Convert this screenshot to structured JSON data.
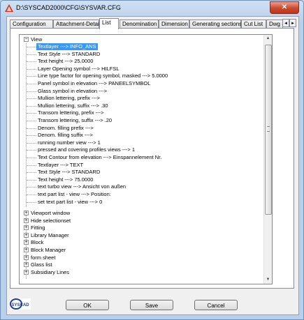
{
  "window": {
    "title": "D:\\SYSCAD2000\\CFG\\SYSVAR.CFG",
    "close_glyph": "✕",
    "icon": "app-icon"
  },
  "tabs": [
    {
      "label": "Configuration",
      "active": false
    },
    {
      "label": "Attachment-Details",
      "active": false
    },
    {
      "label": "List",
      "active": true
    },
    {
      "label": "Denomination",
      "active": false
    },
    {
      "label": "Dimension",
      "active": false
    },
    {
      "label": "Generating sections",
      "active": false
    },
    {
      "label": "Cut List",
      "active": false
    },
    {
      "label": "Dwg S",
      "active": false
    }
  ],
  "tab_scroll": {
    "left": "◄",
    "right": "►"
  },
  "tree": {
    "root": {
      "label": "View",
      "expander": "−"
    },
    "children": [
      "Textlayer  --->  INFO_ANS",
      "Text Style  --->  STANDARD",
      "Text height  --->  25.0000",
      "Layer Opening symbol  --->  HILFSL",
      "Line type factor for opening symbol, masked  --->  5.0000",
      "Panel symbol in elevation  --->  PANEELSYMBOL",
      "Glass symbol in elevation  --->",
      "Mullion lettering, prefix  --->",
      "Mullion lettering, suffix  --->  .30",
      "Transom lettering, prefix  --->",
      "Transom lettering, suffix  --->  .20",
      "Denom. filling prefix  --->",
      "Denom. filling suffix  --->",
      "running number view  --->  1",
      "pressed and covering profiles views  --->  1",
      "Text Contour from elevation  --->  Einspannelement Nr.",
      "Textlayer  --->  TEXT",
      "Text Style  --->  STANDARD",
      "Text height  --->  75.0000",
      "text turbo view  --->  Ansicht von außen",
      "text part list - view  --->  Position:",
      "set text part list - view  --->  0"
    ],
    "collapsed_nodes": [
      "Viewport window",
      "Hide selectionset",
      "Fitting",
      "Library Manager",
      "Block",
      "Block Manager",
      "form sheet",
      "Glass list",
      "Subsidiary Lines"
    ],
    "collapsed_expander": "+",
    "selected_index": 0
  },
  "scrollbar": {
    "up": "▲",
    "down": "▼"
  },
  "buttons": {
    "ok": "OK",
    "save": "Save",
    "cancel": "Cancel"
  },
  "logo": {
    "text": "SYSCAD"
  },
  "colors": {
    "selection": "#3399ff",
    "close": "#c94a2f",
    "logo_blue": "#1f3f8f"
  }
}
